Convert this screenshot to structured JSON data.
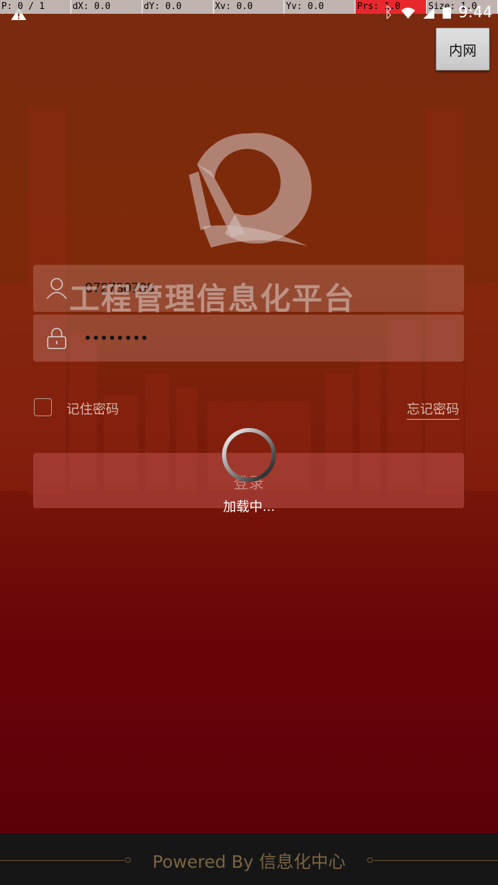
{
  "debug_bar": [
    "P: 0 / 1",
    "dX: 0.0",
    "dY: 0.0",
    "Xv: 0.0",
    "Yv: 0.0",
    "Prs: 1.0",
    "Size: 1.0"
  ],
  "status_bar": {
    "time": "9:44"
  },
  "network_button": "内网",
  "app": {
    "platform_title": "工程管理信息化平台"
  },
  "form": {
    "username": "072730700",
    "password": "••••••••",
    "remember_label": "记住密码",
    "forgot_label": "忘记密码",
    "login_label": "登录"
  },
  "loading": {
    "text": "加载中..."
  },
  "footer": {
    "text": "Powered By 信息化中心"
  },
  "colors": {
    "accent": "#7a2a0e",
    "footer_text": "#7b6543"
  }
}
